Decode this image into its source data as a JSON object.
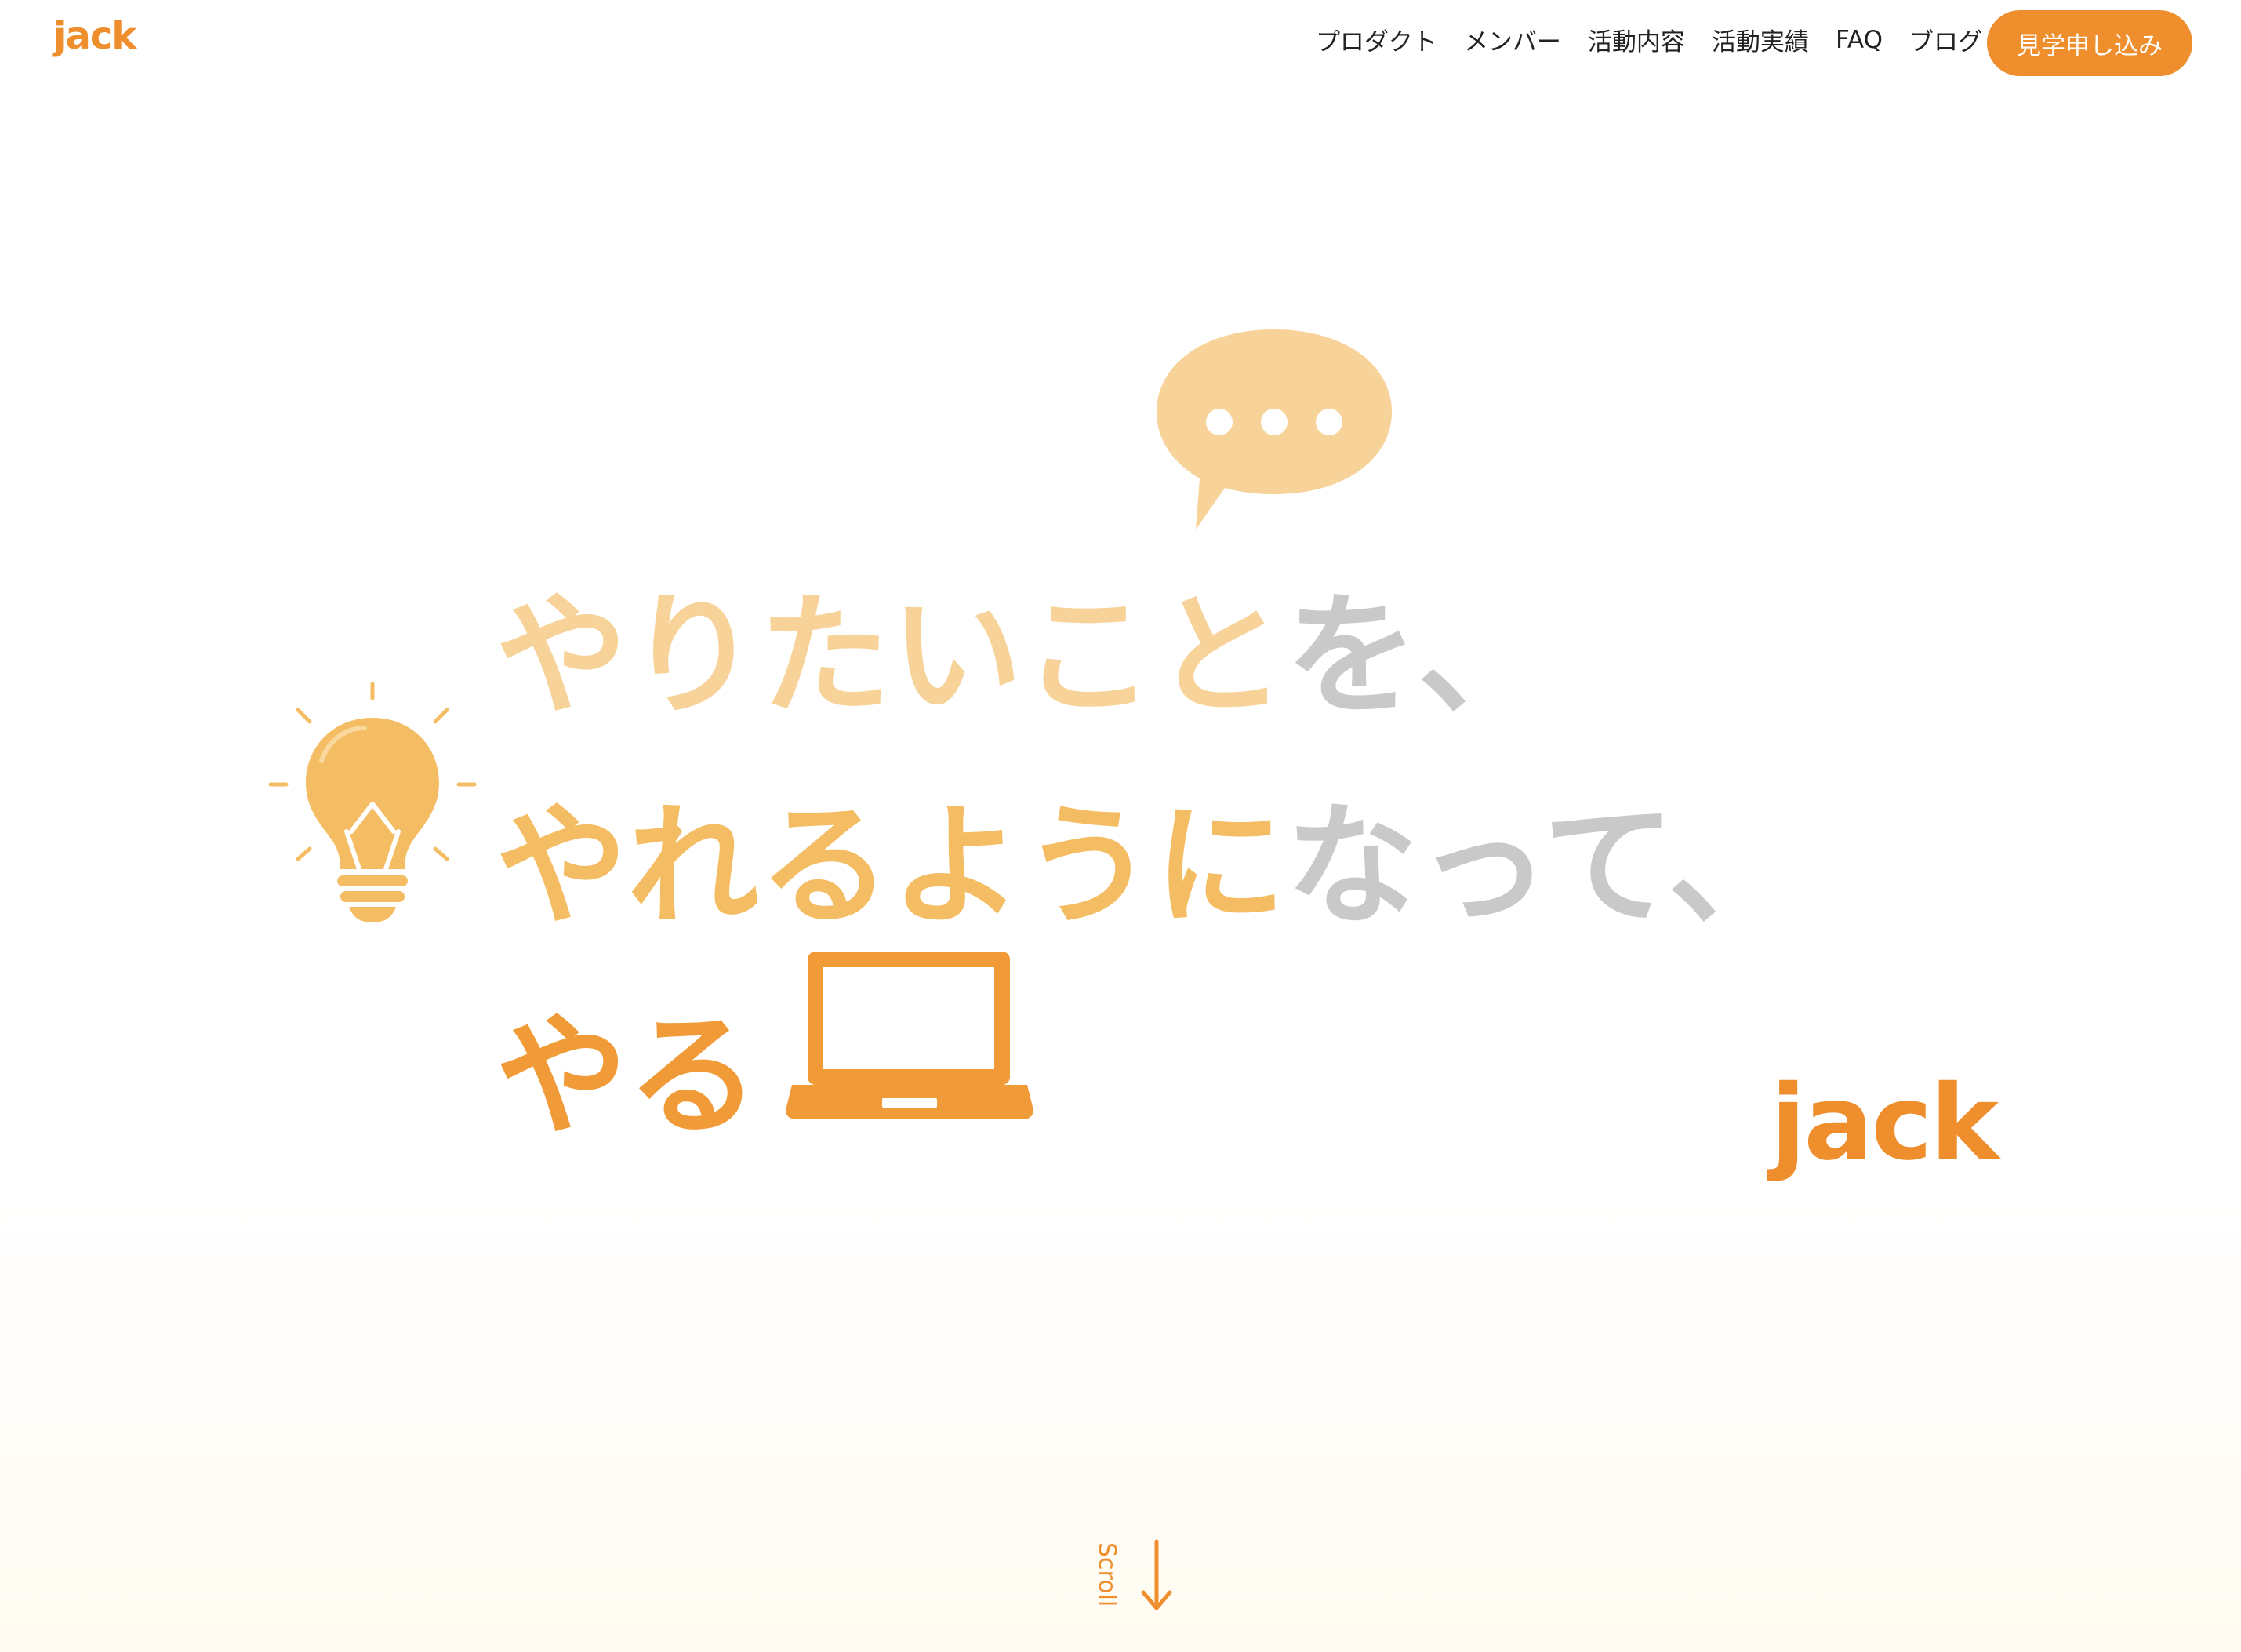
{
  "header": {
    "logo": "jack",
    "nav": [
      "プロダクト",
      "メンバー",
      "活動内容",
      "活動実績",
      "FAQ",
      "ブログ"
    ],
    "cta": "見学申し込み"
  },
  "hero": {
    "line1": [
      {
        "text": "やりたいこと",
        "tone": "light"
      },
      {
        "text": "を、",
        "tone": "gray"
      }
    ],
    "line2": [
      {
        "text": "やれるように",
        "tone": "mid"
      },
      {
        "text": "なって、",
        "tone": "gray"
      }
    ],
    "line3": [
      {
        "text": "やる",
        "tone": "dark"
      }
    ],
    "brand": "jack"
  },
  "scroll": {
    "label": "Scroll"
  },
  "colors": {
    "accent": "#ee8e2d",
    "light_orange": "#f7d39a",
    "mid_orange": "#f4bd63",
    "dark_orange": "#f19b38",
    "gray": "#c9c9c9"
  },
  "icons": [
    "speech-bubble-icon",
    "light-bulb-icon",
    "laptop-icon",
    "arrow-down-icon"
  ]
}
